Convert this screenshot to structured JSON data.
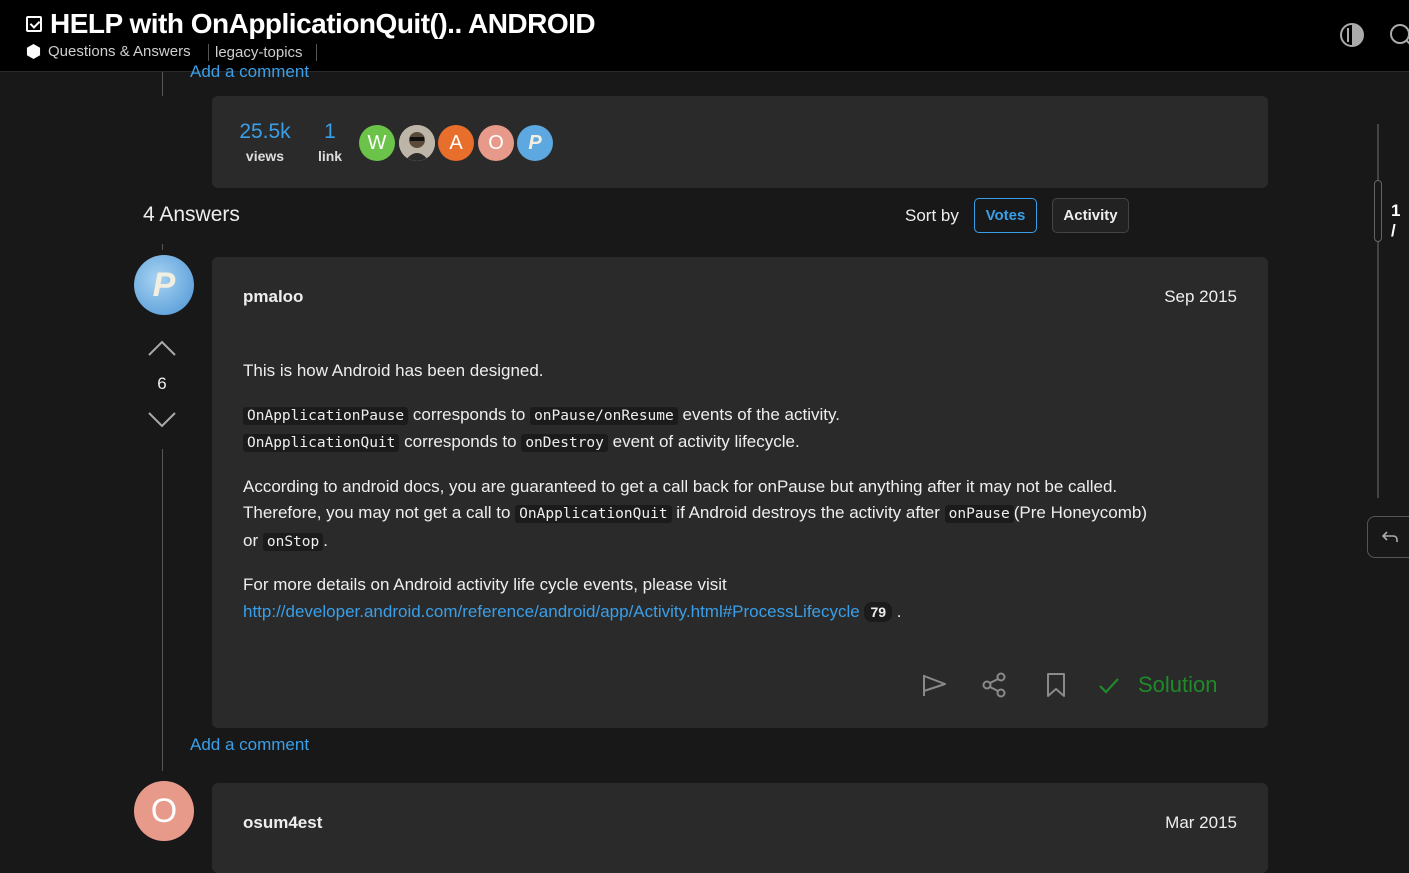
{
  "header": {
    "title": "HELP with OnApplicationQuit().. ANDROID",
    "category": "Questions & Answers",
    "tag": "legacy-topics"
  },
  "topic_summary": {
    "prev_add_comment": "Add a comment",
    "views": "25.5k",
    "views_label": "views",
    "links": "1",
    "links_label": "link",
    "participants": [
      {
        "letter": "W",
        "color": "#6bc34a"
      },
      {
        "letter": "",
        "color": "#c9c9c9"
      },
      {
        "letter": "A",
        "color": "#e86e2c"
      },
      {
        "letter": "O",
        "color": "#e89a8a"
      },
      {
        "letter": "P",
        "color": "#5da8e0"
      }
    ]
  },
  "answers": {
    "count_label": "4 Answers",
    "sort_label": "Sort by",
    "sort_votes": "Votes",
    "sort_activity": "Activity"
  },
  "post1": {
    "author": "pmaloo",
    "date": "Sep 2015",
    "avatar_letter": "P",
    "votes": "6",
    "p1": "This is how Android has been designed.",
    "code_pause": "OnApplicationPause",
    "corresponds_to": "corresponds to",
    "code_onpause_resume": "onPause/onResume",
    "events_activity": "events of the activity.",
    "code_quit": "OnApplicationQuit",
    "code_ondestroy": "onDestroy",
    "event_lifecycle": "event of activity lifecycle.",
    "p3a": "According to android docs, you are guaranteed to get a call back for onPause but anything after it may not be called.",
    "p3b": "Therefore, you may not get a call to",
    "p3c": "if Android destroys the activity after",
    "code_onpause": "onPause",
    "p3d": "(Pre Honeycomb)",
    "or": "or",
    "code_onstop": "onStop",
    "period": ".",
    "p4": "For more details on Android activity life cycle events, please visit",
    "link": "http://developer.android.com/reference/android/app/Activity.html#ProcessLifecycle",
    "link_clicks": "79",
    "solution": "Solution",
    "add_comment": "Add a comment"
  },
  "post2": {
    "author": "osum4est",
    "date": "Mar 2015",
    "avatar_letter": "O"
  },
  "timeline": {
    "progress": "1 /"
  },
  "colors": {
    "accent": "#3a9fe8",
    "solution": "#1f8a2a",
    "card": "#2a2a2a",
    "background": "#181818"
  }
}
